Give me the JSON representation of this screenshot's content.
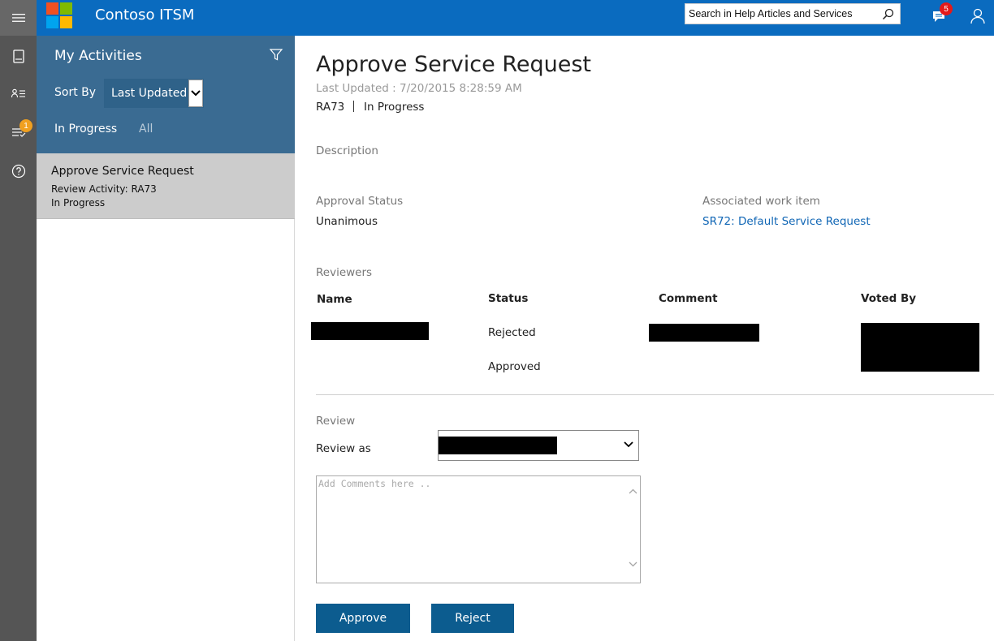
{
  "header": {
    "app_title": "Contoso ITSM",
    "search": {
      "placeholder": "Search in Help Articles and Services"
    },
    "notifications_count": "5",
    "logo_colors": [
      "#f25022",
      "#7fba00",
      "#00a4ef",
      "#ffb900"
    ]
  },
  "rail": {
    "items": [
      "book-icon",
      "contact-list-icon",
      "activities-icon",
      "help-icon"
    ],
    "activities_badge": "1"
  },
  "activities": {
    "title": "My Activities",
    "sort_label": "Sort By",
    "sort_value": "Last Updated",
    "tabs": [
      {
        "label": "In Progress",
        "active": true
      },
      {
        "label": "All",
        "active": false
      }
    ],
    "items": [
      {
        "title": "Approve Service Request",
        "subtitle": "Review Activity: RA73",
        "status": "In Progress"
      }
    ]
  },
  "detail": {
    "title": "Approve Service Request",
    "last_updated": "Last Updated : 7/20/2015 8:28:59 AM",
    "id": "RA73",
    "state": "In Progress",
    "description_label": "Description",
    "approval_status_label": "Approval Status",
    "approval_status_value": "Unanimous",
    "associated_label": "Associated work item",
    "associated_link": "SR72: Default Service Request",
    "reviewers_label": "Reviewers",
    "reviewers_columns": [
      "Name",
      "Status",
      "Comment",
      "Voted By"
    ],
    "reviewers_rows": [
      {
        "status": "Rejected"
      },
      {
        "status": "Approved"
      }
    ],
    "review_label": "Review",
    "review_as_label": "Review as",
    "comments_placeholder": "Add Comments here ..",
    "approve_label": "Approve",
    "reject_label": "Reject"
  },
  "colors": {
    "topbar": "#0a6bbf",
    "rail": "#555555",
    "panel_header": "#3a6b92",
    "button": "#0c5c8f",
    "link": "#1066b5"
  }
}
